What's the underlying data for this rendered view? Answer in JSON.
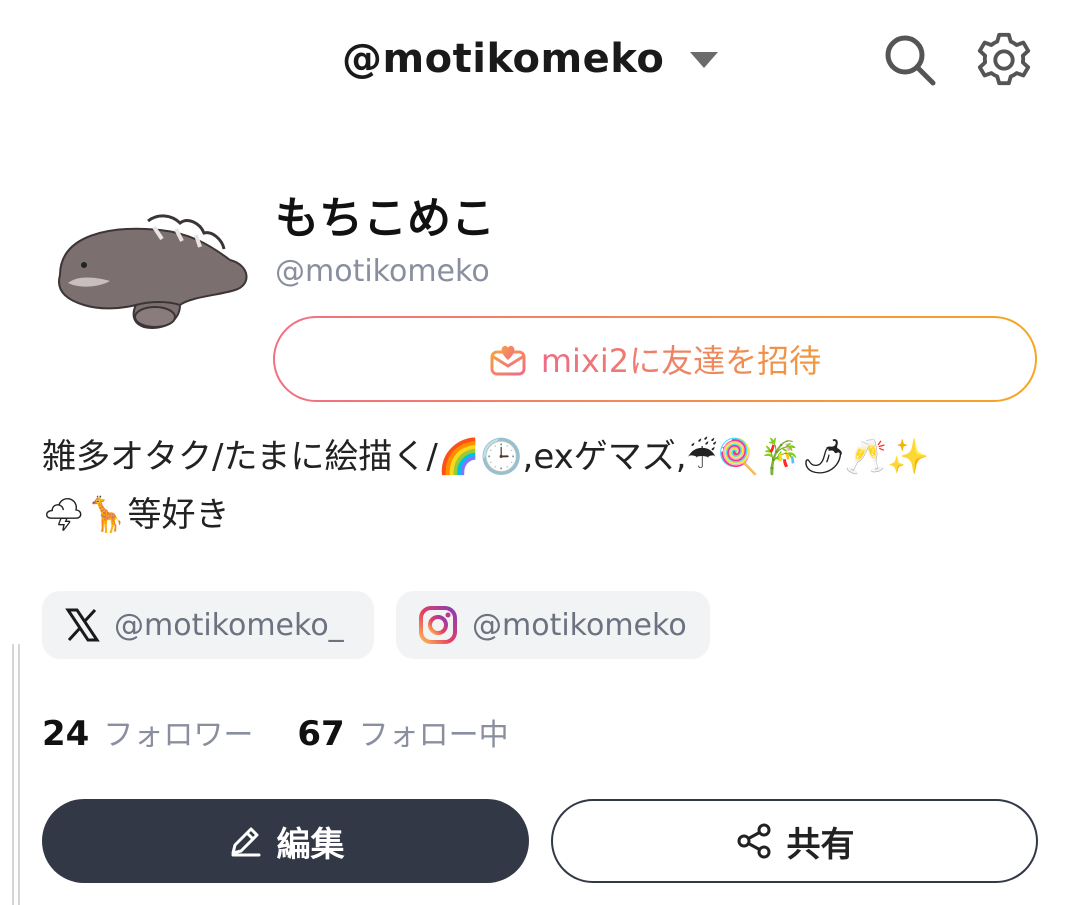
{
  "header": {
    "account": "@motikomeko",
    "icons": [
      "chevron-down-icon",
      "search-icon",
      "gear-icon"
    ]
  },
  "profile": {
    "display_name": "もちこめこ",
    "handle": "@motikomeko",
    "invite_label": "mixi2に友達を招待",
    "bio_line1": "雑多オタク/たまに絵描く/🌈🕒,exゲマズ,☔🍭🎋🌶🥂✨",
    "bio_line2": "🌩🦒等好き"
  },
  "links": {
    "x": "@motikomeko_",
    "instagram": "@motikomeko"
  },
  "stats": {
    "followers_count": "24",
    "followers_label": "フォロワー",
    "following_count": "67",
    "following_label": "フォロー中"
  },
  "actions": {
    "edit_label": "編集",
    "share_label": "共有"
  },
  "colors": {
    "invite_gradient_start": "#f26f84",
    "invite_gradient_end": "#f5a623",
    "primary_button": "#333846",
    "muted_text": "#8a8fa0"
  }
}
